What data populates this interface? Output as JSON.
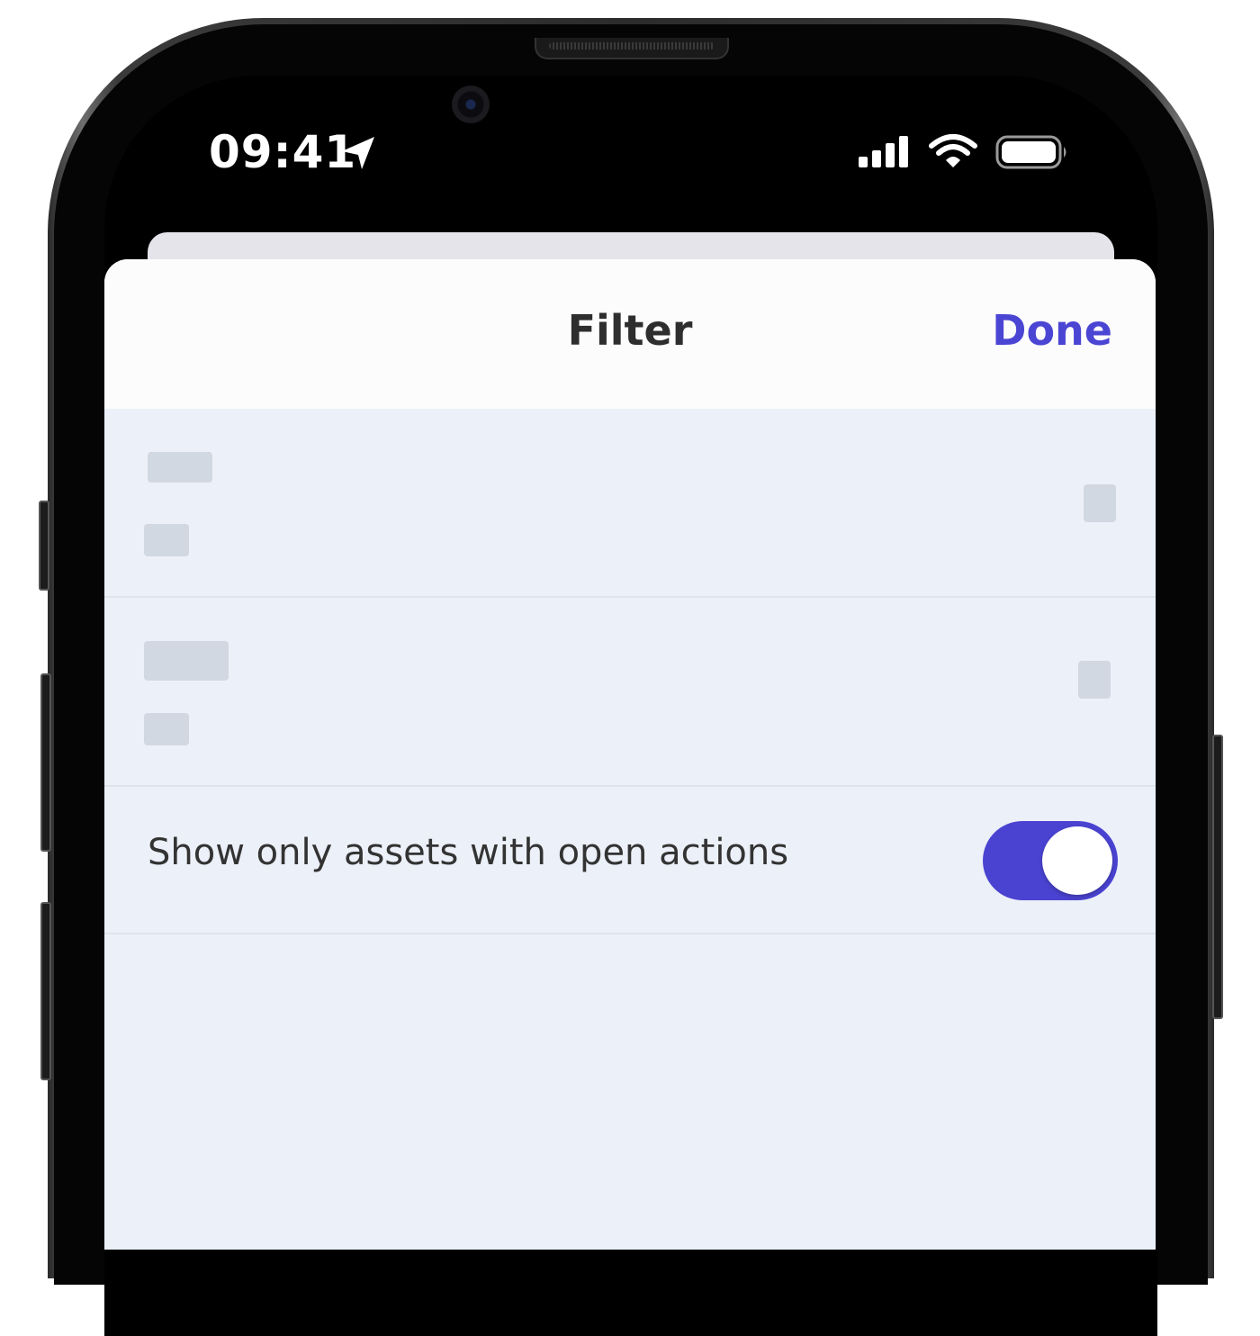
{
  "status_bar": {
    "time": "09:41",
    "icons": [
      "location-arrow-icon",
      "cellular-signal-icon",
      "wifi-icon",
      "battery-icon"
    ]
  },
  "sheet": {
    "title": "Filter",
    "done_label": "Done",
    "toggle_row": {
      "label": "Show only assets with open actions",
      "enabled": true
    }
  },
  "colors": {
    "accent": "#4b45d4",
    "sheet_background": "#ecf0f8",
    "header_background": "#fcfcfd",
    "placeholder": "#d2d8e2"
  }
}
